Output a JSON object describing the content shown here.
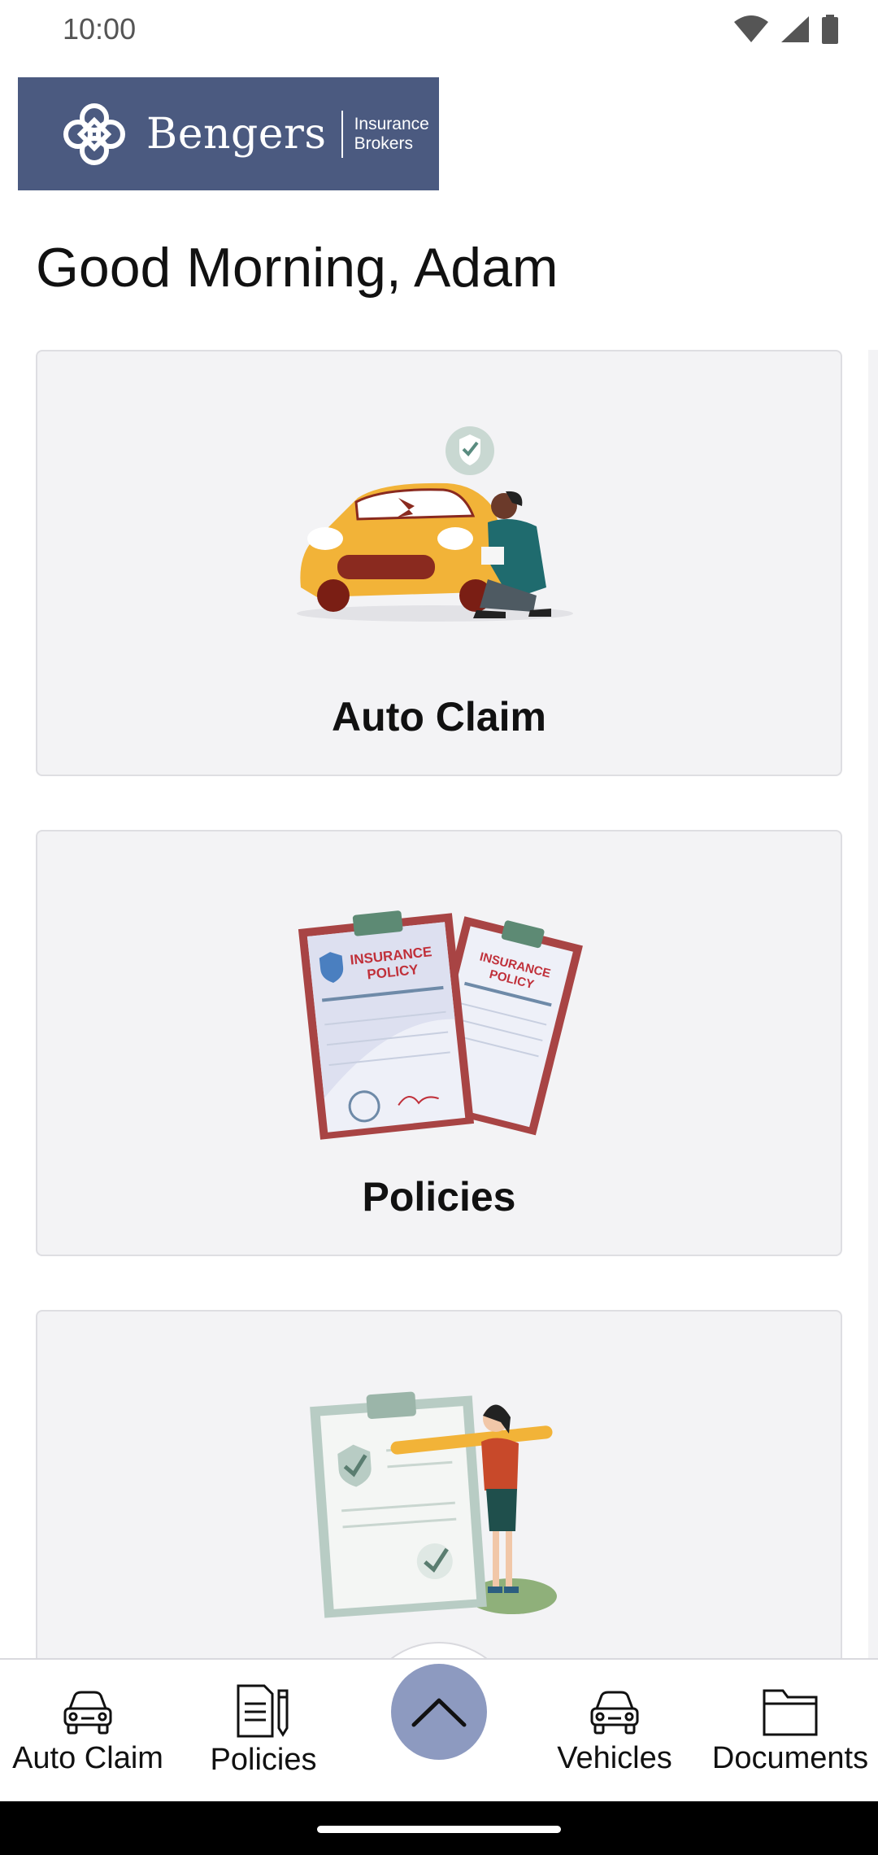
{
  "status_bar": {
    "time": "10:00",
    "icons": [
      "wifi-icon",
      "signal-icon",
      "battery-icon"
    ]
  },
  "logo": {
    "name": "Bengers",
    "subtitle_line1": "Insurance",
    "subtitle_line2": "Brokers",
    "background_color": "#4b5a80"
  },
  "greeting": "Good Morning, Adam",
  "cards": [
    {
      "title": "Auto Claim",
      "illustration": "car-claim-illustration"
    },
    {
      "title": "Policies",
      "illustration": "insurance-policy-illustration",
      "doc_text_line1": "INSURANCE",
      "doc_text_line2": "POLICY"
    },
    {
      "title": "",
      "illustration": "checklist-illustration"
    }
  ],
  "bottom_nav": {
    "items": [
      {
        "label": "Auto Claim",
        "icon": "car-icon"
      },
      {
        "label": "Policies",
        "icon": "document-pen-icon"
      },
      {
        "label": "Vehicles",
        "icon": "car-icon"
      },
      {
        "label": "Documents",
        "icon": "folder-icon"
      }
    ],
    "center_button_icon": "chevron-up-icon",
    "center_button_color": "#8d9ac0"
  }
}
